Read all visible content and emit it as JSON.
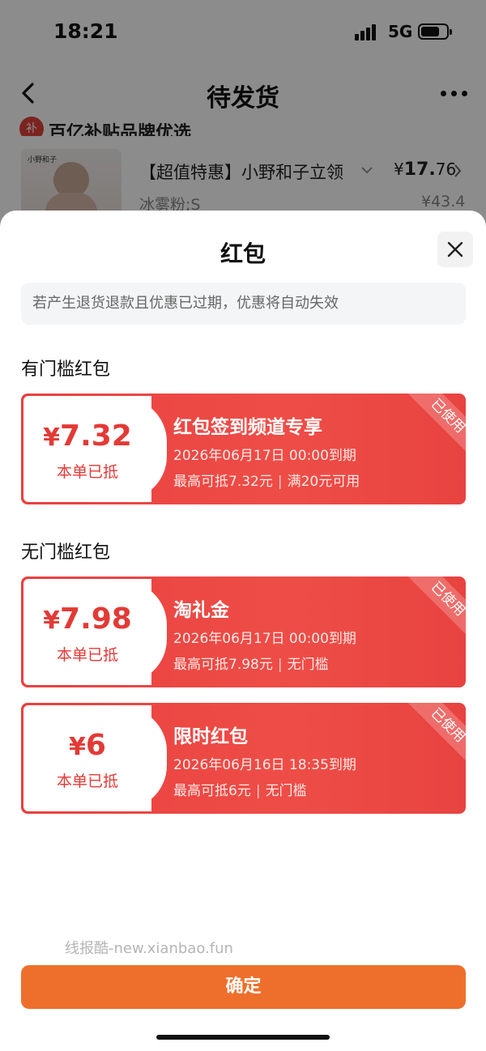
{
  "status_bar": {
    "time": "18:21",
    "network": "5G"
  },
  "nav": {
    "title": "待发货",
    "back_icon": "chevron-left-icon",
    "more_icon": "more-dots-icon"
  },
  "order": {
    "shop_name": "百亿补贴品牌优选",
    "thumb_brand": "小野和子",
    "product_title": "【超值特惠】小野和子立领",
    "price_symbol": "¥",
    "price_int": "17.",
    "price_dec": "76",
    "spec": "冰雾粉;S",
    "original_price": "¥43.4"
  },
  "sheet": {
    "title": "红包",
    "notice": "若产生退货退款且优惠已过期，优惠将自动失效",
    "confirm_label": "确定",
    "watermark": "线报酷-new.xianbao.fun"
  },
  "sections": [
    {
      "heading": "有门槛红包"
    },
    {
      "heading": "无门槛红包"
    }
  ],
  "coupons": [
    {
      "currency": "¥",
      "amount": "7.32",
      "status": "本单已抵",
      "title": "红包签到频道专享",
      "expiry": "2026年06月17日 00:00到期",
      "max_deduct": "最高可抵7.32元",
      "threshold": "满20元可用",
      "badge": "已使用"
    },
    {
      "currency": "¥",
      "amount": "7.98",
      "status": "本单已抵",
      "title": "淘礼金",
      "expiry": "2026年06月17日 00:00到期",
      "max_deduct": "最高可抵7.98元",
      "threshold": "无门槛",
      "badge": "已使用"
    },
    {
      "currency": "¥",
      "amount": "6",
      "status": "本单已抵",
      "title": "限时红包",
      "expiry": "2026年06月16日 18:35到期",
      "max_deduct": "最高可抵6元",
      "threshold": "无门槛",
      "badge": "已使用"
    }
  ],
  "colors": {
    "coupon_red": "#e9403f",
    "confirm_orange": "#ee6f2b",
    "amount_red": "#e33a36"
  }
}
